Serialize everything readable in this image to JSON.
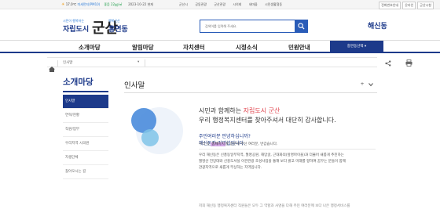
{
  "topbar": {
    "temperature": "17.0℃",
    "fine_dust": "미세먼지(PM10)",
    "air_quality": "좋음 22㎍/㎥",
    "date": "2023-10-22 현재",
    "links": [
      "군산시",
      "공동관광",
      "군산관광",
      "시의회",
      "새마을",
      "시민생활협동"
    ],
    "right_buttons": [
      "전화번호안내",
      "온라인",
      "군산시청"
    ]
  },
  "header": {
    "logo_tagline": "시민이 행복하는",
    "logo_city": "자립도시",
    "logo_mark": "군산",
    "logo_brand_small": "행복군산",
    "logo_dong": "흥면동",
    "search_placeholder": "검색어를 입력해 주세요.",
    "site_name": "해신동"
  },
  "gnb": {
    "items": [
      "소개마당",
      "알림마당",
      "자치센터",
      "시정소식",
      "민원안내"
    ],
    "dong_select": "흥면동선택 ▾"
  },
  "breadcrumb": {
    "location": "인사말",
    "dropdown": "▾"
  },
  "lnb": {
    "title": "소개마당",
    "items": [
      "인사말",
      "연혁/현황",
      "직원/업무",
      "우리지역 시의원",
      "자생단체",
      "찾아오시는 길"
    ]
  },
  "content": {
    "title": "인사말",
    "plus": "+",
    "greeting_line1_pre": "시민과 함께하는 ",
    "greeting_line1_hl": "자립도시 군산",
    "greeting_line2": "우리 행정복지센터를 찾아주셔서 대단히 감사합니다.",
    "intro_line1": "주민여러분 안녕하십니까?",
    "intro_line2": "해신동장 김영섭입니다.",
    "p1_pre": "우리 동 ",
    "p1_mark": "홈페이지",
    "p1_post": "를 방문해 주신 여러분, 반갑습니다.",
    "p2_lines": [
      "우리 해신동은 신풍동일부지역, 월명공원, 해망굴, 근대화의(앞명마이을)과 더불어 새롭게 추진하는",
      "월명산 전망대와 신흥도서실 이관관광 조성사업을 통해 보다 밝고 미래를 향하여 꿈꾸는 분들이 함께",
      "관광지역으로 새롭게 부상하는 지역입니다."
    ],
    "p3": "저희 해신동 행정복지센터 직원들은 모두 그 역할과 사명을 다해 주민 여러분께 보다 나은 행정서비스를"
  }
}
